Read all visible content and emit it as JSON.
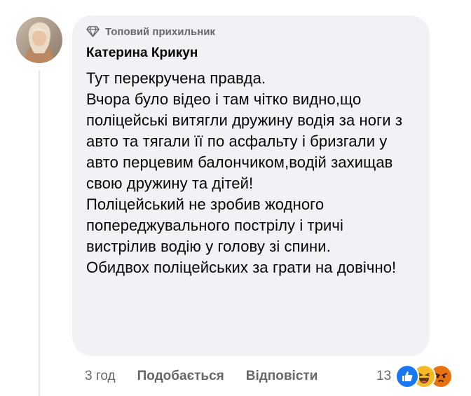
{
  "comment": {
    "badge": "Топовий прихильник",
    "author": "Катерина Крикун",
    "text": "Тут перекручена правда.\nВчора було відео і там чітко видно,що поліцейські витягли дружину водія за ноги з авто та тягали її по асфальту і бризгали у авто перцевим балончиком,водій захищав свою дружину та дітей!\nПоліцейський не зробив жодного попереджувального пострілу і тричі вистрілив водію у голову зі спини.\nОбидвох поліцейських за грати на довічно!"
  },
  "actions": {
    "time": "3 год",
    "like": "Подобається",
    "reply": "Відповісти"
  },
  "reactions": {
    "count": "13",
    "icons": [
      "like-reaction-icon",
      "haha-reaction-icon",
      "angry-reaction-icon"
    ]
  },
  "colors": {
    "bubble": "#f0f2f5",
    "secondary_text": "#65676b",
    "primary_text": "#050505",
    "like_blue": "#1877f2",
    "haha_yellow": "#f7b928",
    "angry_orange": "#e9710f"
  }
}
